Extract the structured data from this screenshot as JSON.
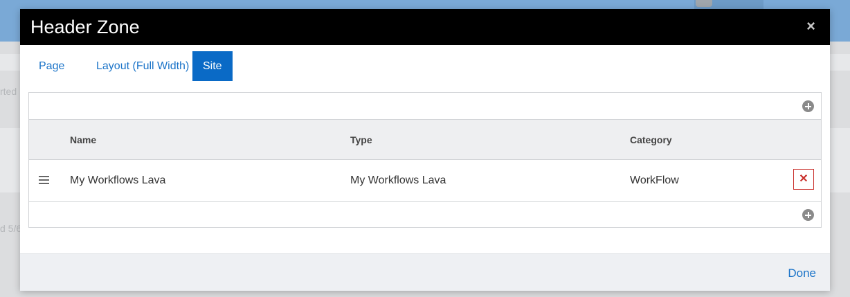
{
  "background": {
    "text_1": "rted",
    "text_2": "d 5/6"
  },
  "modal": {
    "title": "Header Zone",
    "close_icon": "close-icon",
    "tabs": [
      {
        "label": "Page",
        "active": false
      },
      {
        "label": "Layout (Full Width)",
        "active": false
      },
      {
        "label": "Site",
        "active": true
      }
    ],
    "grid": {
      "columns": [
        "Name",
        "Type",
        "Category"
      ],
      "rows": [
        {
          "name": "My Workflows Lava",
          "type": "My Workflows Lava",
          "category": "WorkFlow"
        }
      ]
    },
    "footer": {
      "done_label": "Done"
    }
  },
  "colors": {
    "accent": "#0a6ac6",
    "link": "#1a73c8",
    "header_bg": "#000000",
    "danger": "#c9302c"
  }
}
